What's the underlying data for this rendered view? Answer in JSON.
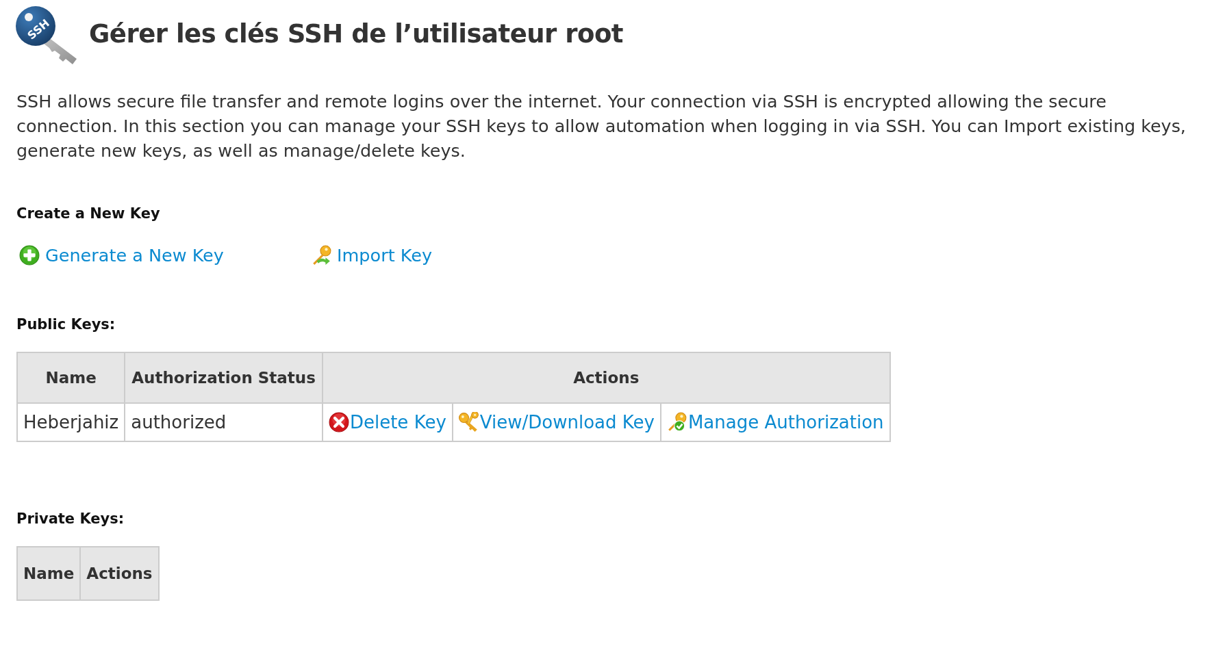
{
  "header": {
    "icon_text": "SSH",
    "title": "Gérer les clés SSH de l’utilisateur root"
  },
  "intro": "SSH allows secure file transfer and remote logins over the internet. Your connection via SSH is encrypted allowing the secure connection. In this section you can manage your SSH keys to allow automation when logging in via SSH. You can Import existing keys, generate new keys, as well as manage/delete keys.",
  "create_section": {
    "heading": "Create a New Key",
    "links": [
      {
        "kind": "generate",
        "label": "Generate a New Key"
      },
      {
        "kind": "import",
        "label": "Import Key"
      }
    ]
  },
  "public_keys": {
    "heading": "Public Keys:",
    "columns": [
      "Name",
      "Authorization Status",
      "Actions"
    ],
    "rows": [
      {
        "name": "Heberjahiz",
        "status": "authorized",
        "actions": [
          {
            "kind": "delete",
            "label": "Delete Key"
          },
          {
            "kind": "view",
            "label": "View/Download Key"
          },
          {
            "kind": "manage",
            "label": "Manage Authorization"
          }
        ]
      }
    ]
  },
  "private_keys": {
    "heading": "Private Keys:",
    "columns": [
      "Name",
      "Actions"
    ]
  }
}
